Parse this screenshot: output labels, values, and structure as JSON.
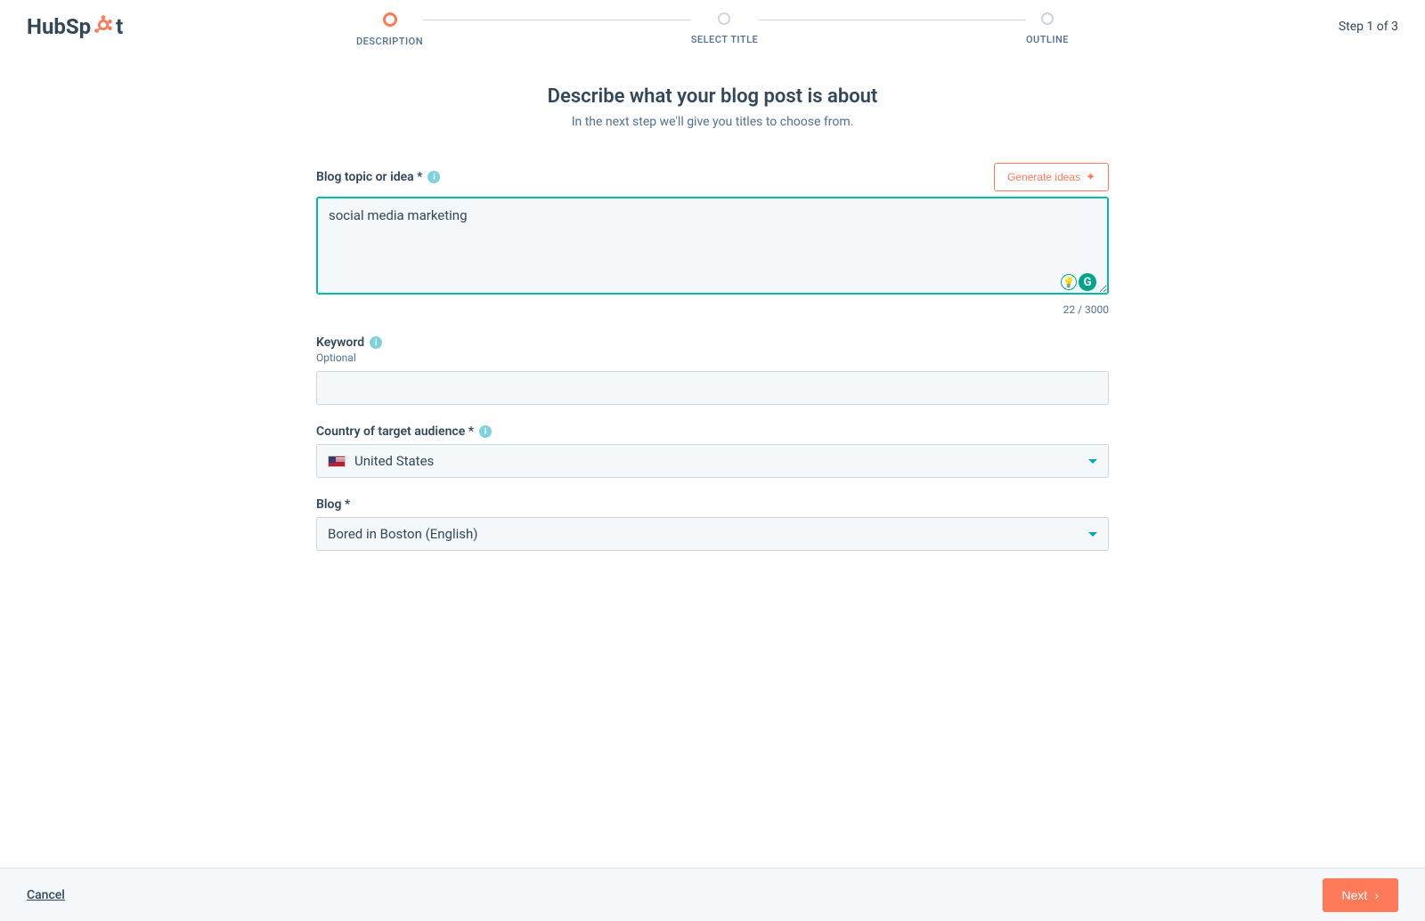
{
  "brand": "HubSpot",
  "stepper": {
    "steps": [
      {
        "label": "DESCRIPTION"
      },
      {
        "label": "SELECT TITLE"
      },
      {
        "label": "OUTLINE"
      }
    ],
    "indicator": "Step 1 of 3"
  },
  "page": {
    "title": "Describe what your blog post is about",
    "subtitle": "In the next step we'll give you titles to choose from."
  },
  "topic": {
    "label": "Blog topic or idea *",
    "value": "social media marketing",
    "generate_label": "Generate ideas",
    "char_count": "22 / 3000"
  },
  "keyword": {
    "label": "Keyword",
    "optional": "Optional",
    "value": ""
  },
  "country": {
    "label": "Country of target audience *",
    "value": "United States"
  },
  "blog": {
    "label": "Blog *",
    "value": "Bored in Boston (English)"
  },
  "footer": {
    "cancel": "Cancel",
    "next": "Next"
  }
}
